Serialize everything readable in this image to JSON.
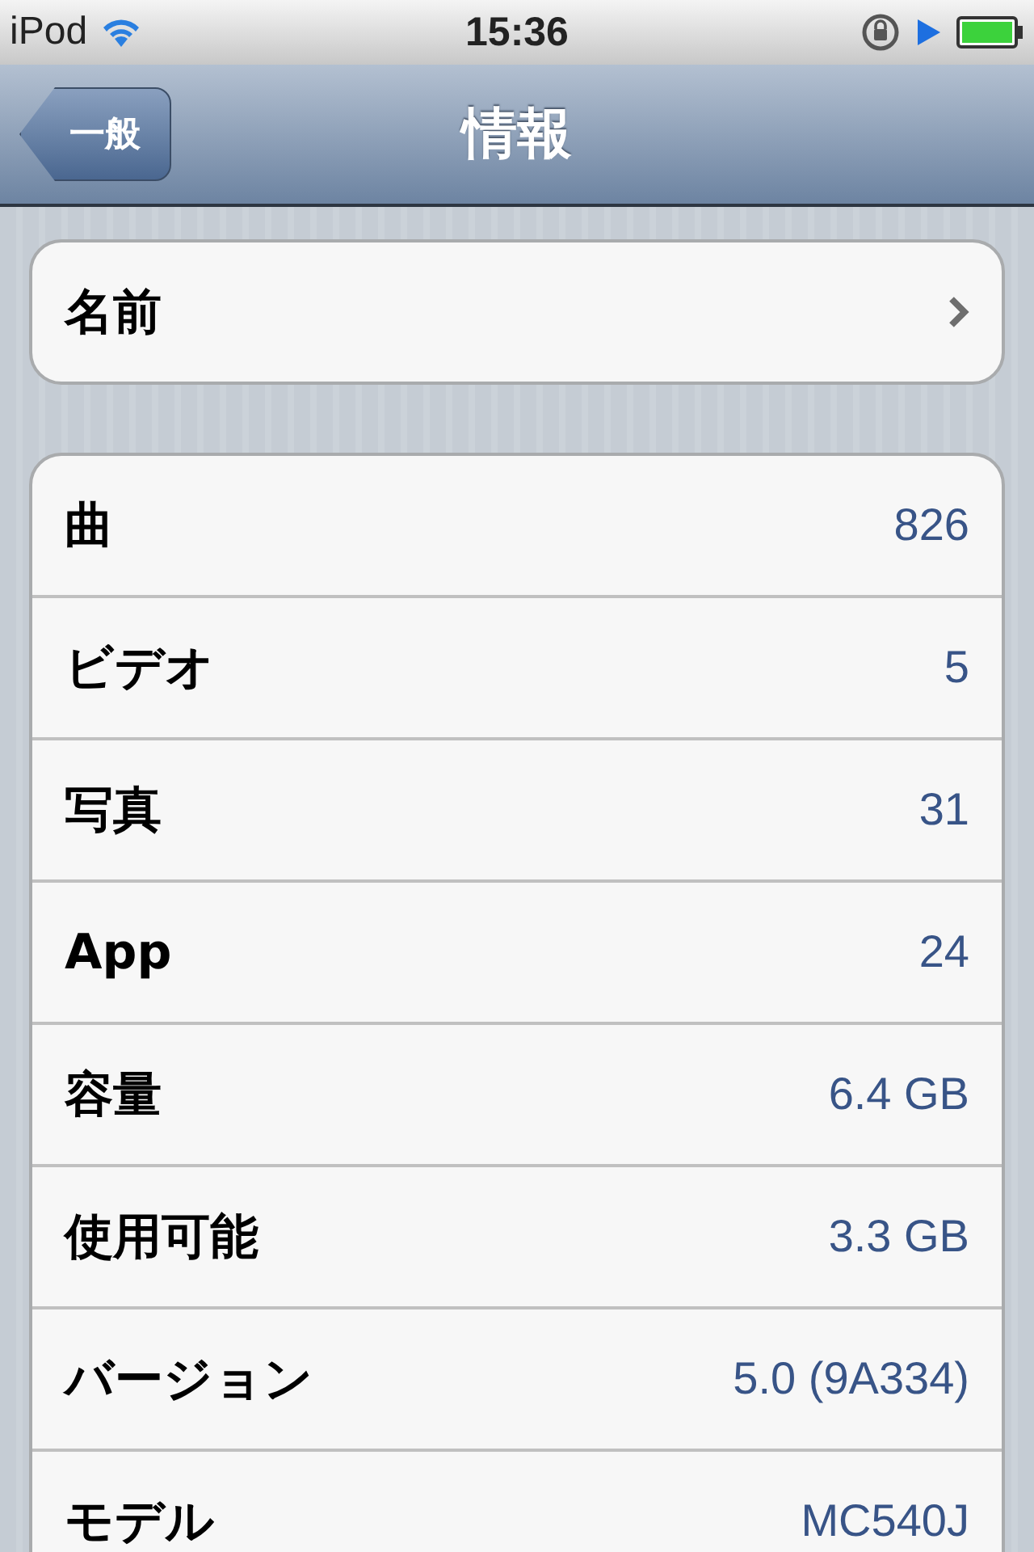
{
  "status_bar": {
    "carrier": "iPod",
    "time": "15:36"
  },
  "nav": {
    "back": "一般",
    "title": "情報"
  },
  "name_row": {
    "label": "名前"
  },
  "info_rows": [
    {
      "label": "曲",
      "value": "826"
    },
    {
      "label": "ビデオ",
      "value": "5"
    },
    {
      "label": "写真",
      "value": "31"
    },
    {
      "label": "App",
      "value": "24"
    },
    {
      "label": "容量",
      "value": "6.4 GB"
    },
    {
      "label": "使用可能",
      "value": "3.3 GB"
    },
    {
      "label": "バージョン",
      "value": "5.0 (9A334)"
    },
    {
      "label": "モデル",
      "value": "MC540J"
    }
  ]
}
